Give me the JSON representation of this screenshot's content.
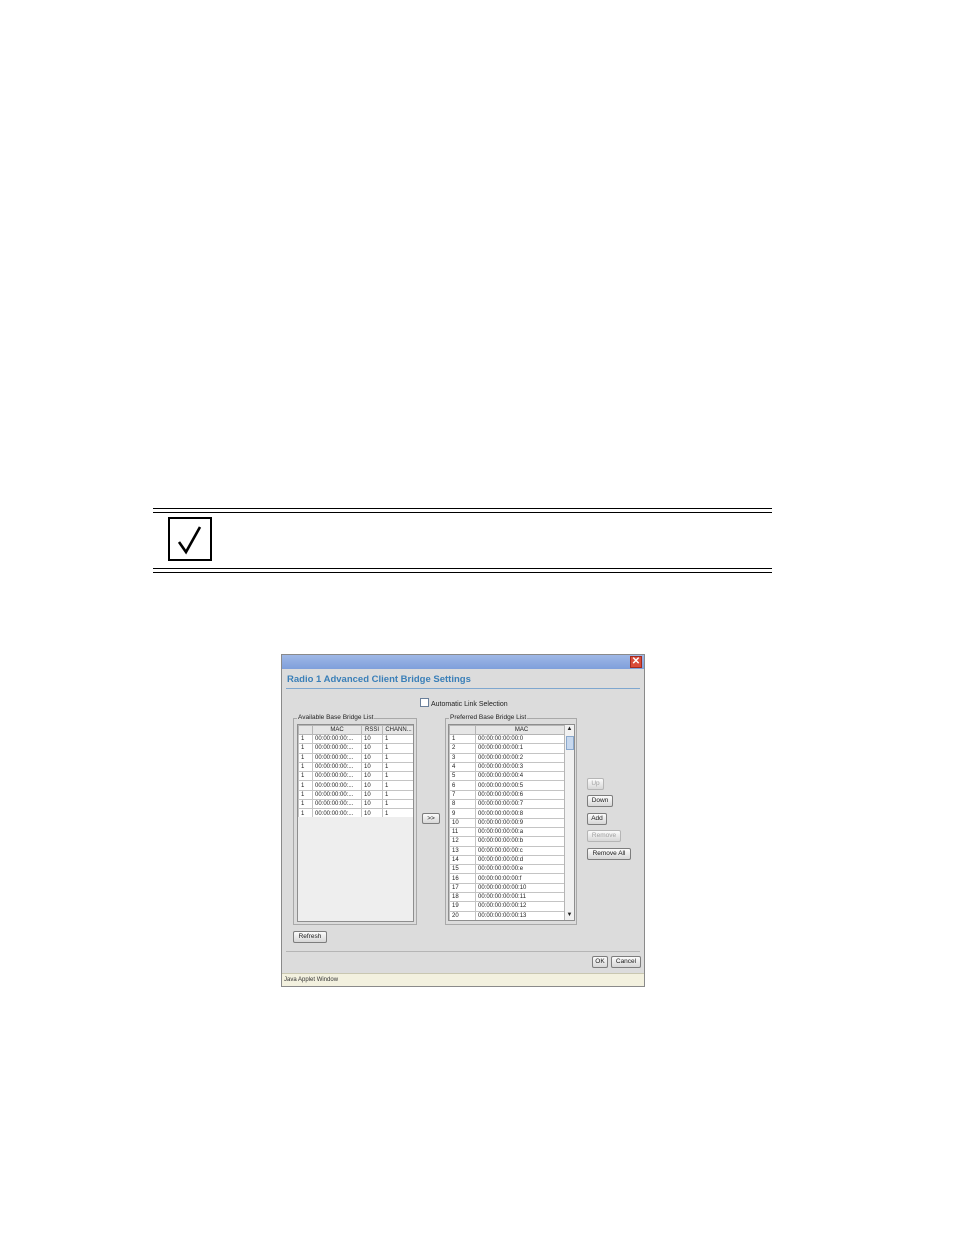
{
  "dialog": {
    "close_glyph": "✕",
    "title": "Radio 1 Advanced Client Bridge Settings",
    "auto_link_label": "Automatic Link Selection",
    "available": {
      "title": "Available Base Bridge List",
      "columns": [
        "",
        "MAC",
        "RSSI",
        "CHANN..."
      ],
      "rows": [
        [
          "1",
          "00:00:00:00:...",
          "10",
          "1"
        ],
        [
          "1",
          "00:00:00:00:...",
          "10",
          "1"
        ],
        [
          "1",
          "00:00:00:00:...",
          "10",
          "1"
        ],
        [
          "1",
          "00:00:00:00:...",
          "10",
          "1"
        ],
        [
          "1",
          "00:00:00:00:...",
          "10",
          "1"
        ],
        [
          "1",
          "00:00:00:00:...",
          "10",
          "1"
        ],
        [
          "1",
          "00:00:00:00:...",
          "10",
          "1"
        ],
        [
          "1",
          "00:00:00:00:...",
          "10",
          "1"
        ],
        [
          "1",
          "00:00:00:00:...",
          "10",
          "1"
        ]
      ]
    },
    "move_button": ">>",
    "preferred": {
      "title": "Preferred Base Bridge List",
      "columns": [
        "",
        "MAC"
      ],
      "rows": [
        [
          "1",
          "00:00:00:00:00:0"
        ],
        [
          "2",
          "00:00:00:00:00:1"
        ],
        [
          "3",
          "00:00:00:00:00:2"
        ],
        [
          "4",
          "00:00:00:00:00:3"
        ],
        [
          "5",
          "00:00:00:00:00:4"
        ],
        [
          "6",
          "00:00:00:00:00:5"
        ],
        [
          "7",
          "00:00:00:00:00:6"
        ],
        [
          "8",
          "00:00:00:00:00:7"
        ],
        [
          "9",
          "00:00:00:00:00:8"
        ],
        [
          "10",
          "00:00:00:00:00:9"
        ],
        [
          "11",
          "00:00:00:00:00:a"
        ],
        [
          "12",
          "00:00:00:00:00:b"
        ],
        [
          "13",
          "00:00:00:00:00:c"
        ],
        [
          "14",
          "00:00:00:00:00:d"
        ],
        [
          "15",
          "00:00:00:00:00:e"
        ],
        [
          "16",
          "00:00:00:00:00:f"
        ],
        [
          "17",
          "00:00:00:00:00:10"
        ],
        [
          "18",
          "00:00:00:00:00:11"
        ],
        [
          "19",
          "00:00:00:00:00:12"
        ],
        [
          "20",
          "00:00:00:00:00:13"
        ]
      ]
    },
    "buttons": {
      "up": "Up",
      "down": "Down",
      "add": "Add",
      "remove": "Remove",
      "remove_all": "Remove All",
      "refresh": "Refresh",
      "ok": "OK",
      "cancel": "Cancel"
    },
    "status_bar": "Java Applet Window",
    "colors": {
      "title_text": "#3a7fb8",
      "titlebar": "#7f9fdb",
      "close": "#d94a3a"
    }
  }
}
